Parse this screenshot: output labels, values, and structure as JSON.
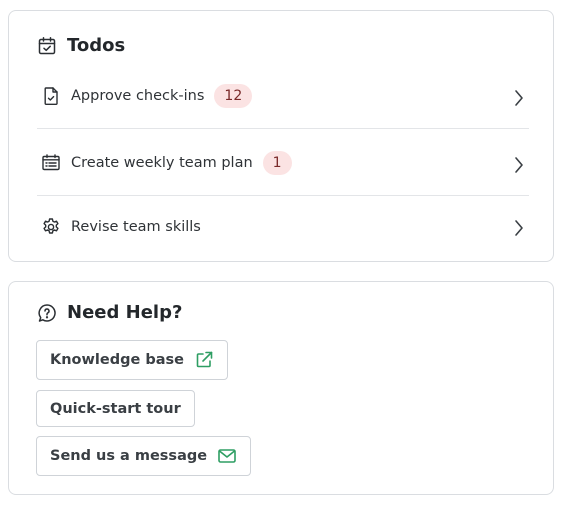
{
  "todos": {
    "title": "Todos",
    "title_icon": "calendar-check-icon",
    "items": [
      {
        "label": "Approve check-ins",
        "badge": "12",
        "icon": "document-check-icon"
      },
      {
        "label": "Create weekly team plan",
        "badge": "1",
        "icon": "calendar-list-icon"
      },
      {
        "label": "Revise team skills",
        "icon": "gear-icon"
      }
    ]
  },
  "help": {
    "title": "Need Help?",
    "title_icon": "question-bubble-icon",
    "buttons": [
      {
        "label": "Knowledge base",
        "icon": "external-link-icon"
      },
      {
        "label": "Quick-start tour"
      },
      {
        "label": "Send us a message",
        "icon": "mail-icon"
      }
    ]
  },
  "colors": {
    "accent_green": "#2e9e63",
    "badge_bg": "#fbe3e3",
    "border": "#dadde1"
  }
}
